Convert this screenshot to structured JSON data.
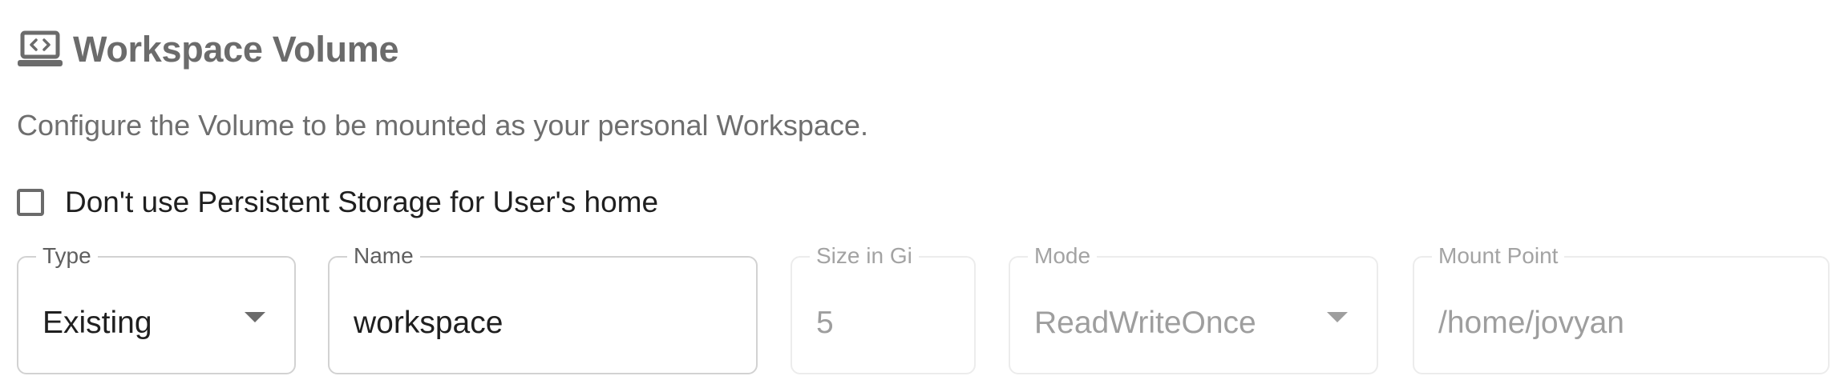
{
  "section": {
    "title": "Workspace Volume",
    "icon": "laptop-code-icon",
    "description": "Configure the Volume to be mounted as your personal Workspace."
  },
  "checkbox": {
    "label": "Don't use Persistent Storage for User's home",
    "checked": false
  },
  "fields": {
    "type": {
      "label": "Type",
      "value": "Existing",
      "disabled": false
    },
    "name": {
      "label": "Name",
      "value": "workspace",
      "disabled": false
    },
    "size": {
      "label": "Size in Gi",
      "value": "5",
      "disabled": true
    },
    "mode": {
      "label": "Mode",
      "value": "ReadWriteOnce",
      "disabled": true
    },
    "mount_point": {
      "label": "Mount Point",
      "value": "/home/jovyan",
      "disabled": true
    }
  },
  "colors": {
    "heading": "#6b6b6b",
    "text": "#1f1f1f",
    "muted": "#9e9e9e",
    "border": "#d2d2d2"
  }
}
